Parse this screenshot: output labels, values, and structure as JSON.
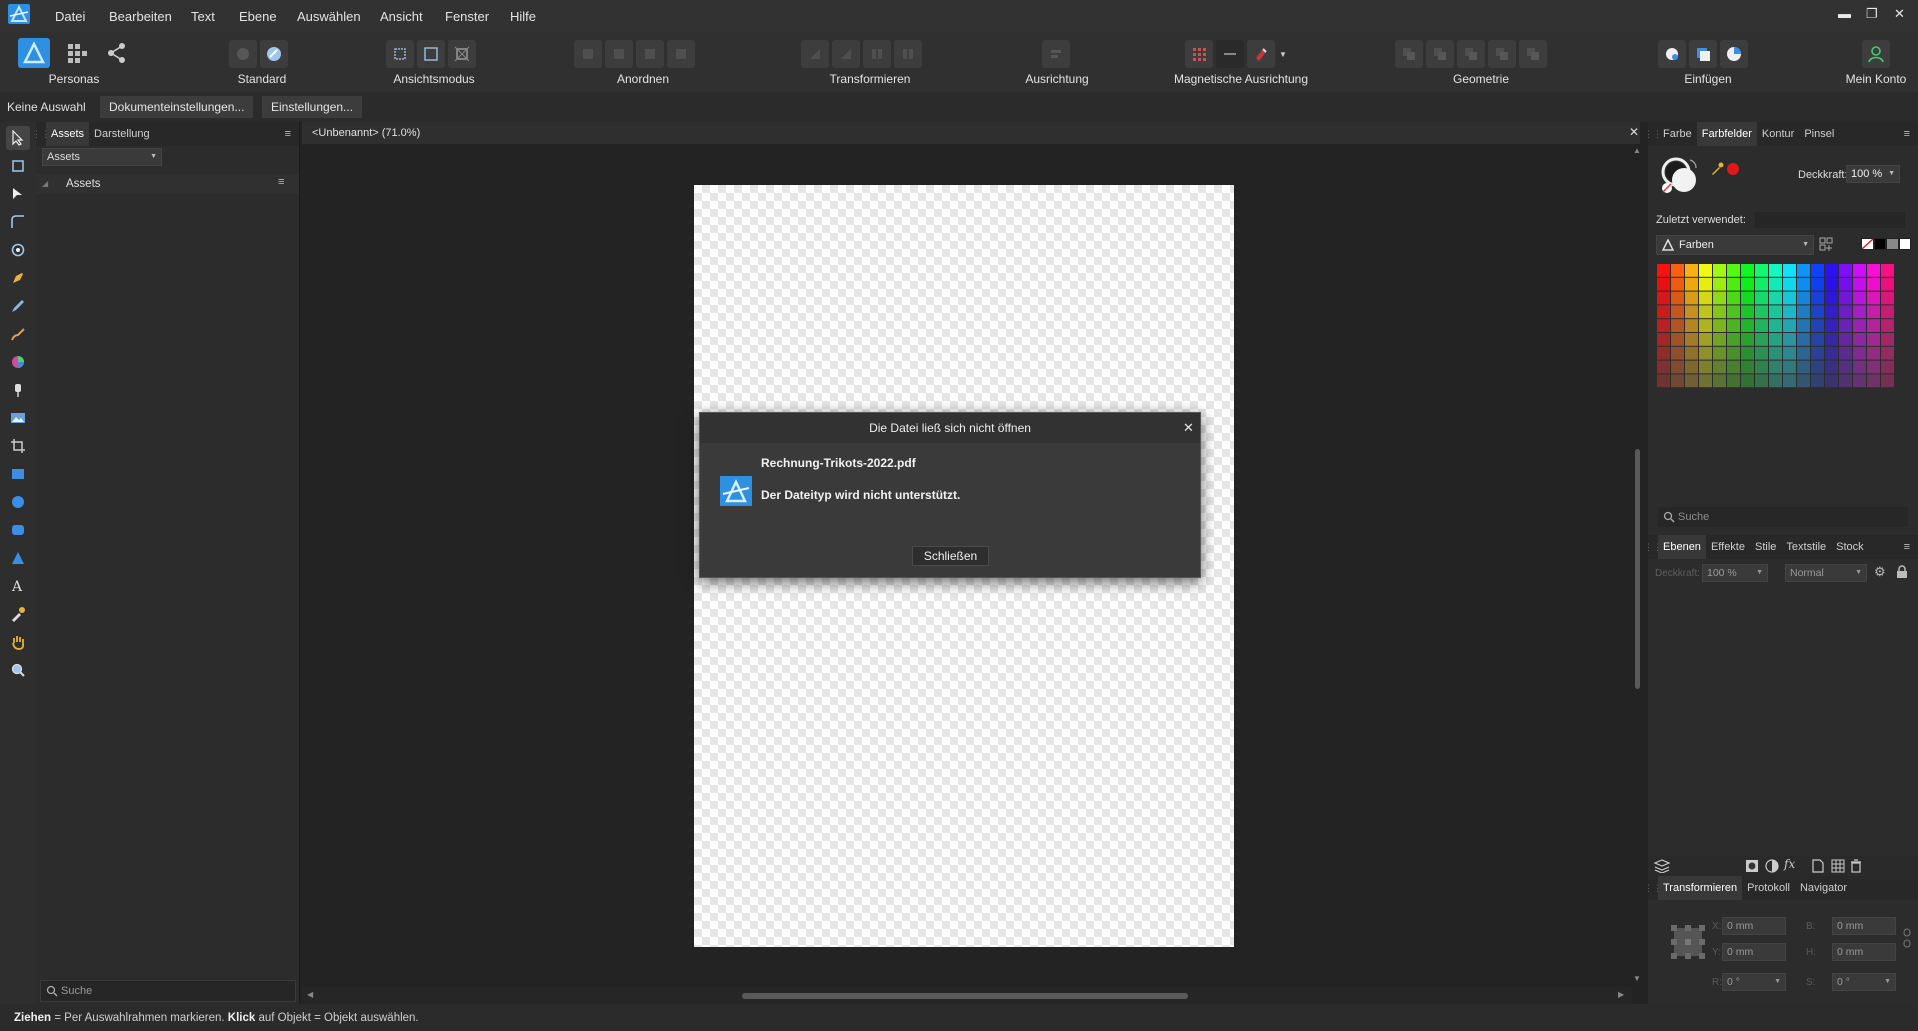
{
  "menubar": {
    "items": [
      "Datei",
      "Bearbeiten",
      "Text",
      "Ebene",
      "Auswählen",
      "Ansicht",
      "Fenster",
      "Hilfe"
    ],
    "window_controls": [
      "▬",
      "❐",
      "✕"
    ]
  },
  "toolbar": {
    "personas_label": "Personas",
    "groups": [
      "Standard",
      "Ansichtsmodus",
      "Anordnen",
      "Transformieren",
      "Ausrichtung",
      "Magnetische Ausrichtung",
      "Geometrie",
      "Einfügen",
      "Mein Konto"
    ]
  },
  "context_bar": {
    "selection": "Keine Auswahl",
    "doc_settings": "Dokumenteinstellungen...",
    "settings": "Einstellungen..."
  },
  "assets_panel": {
    "tabs": [
      "Assets",
      "Darstellung"
    ],
    "dropdown": "Assets",
    "section": "Assets",
    "search_placeholder": "Suche"
  },
  "document": {
    "tab_title": "<Unbenannt> (71.0%)"
  },
  "dialog": {
    "title": "Die Datei ließ sich nicht öffnen",
    "filename": "Rechnung-Trikots-2022.pdf",
    "message": "Der Dateityp wird nicht unterstützt.",
    "close_button": "Schließen"
  },
  "color_panel": {
    "tabs": [
      "Farbe",
      "Farbfelder",
      "Kontur",
      "Pinsel"
    ],
    "opacity_label": "Deckkraft:",
    "opacity_value": "100 %",
    "recent_label": "Zuletzt verwendet:",
    "palette_name": "Farben",
    "search_placeholder": "Suche"
  },
  "layers_panel": {
    "tabs": [
      "Ebenen",
      "Effekte",
      "Stile",
      "Textstile",
      "Stock"
    ],
    "opacity_label": "Deckkraft:",
    "opacity_value": "100 %",
    "blend_mode": "Normal"
  },
  "transform_panel": {
    "tabs": [
      "Transformieren",
      "Protokoll",
      "Navigator"
    ],
    "fields": [
      {
        "label": "X:",
        "value": "0 mm"
      },
      {
        "label": "B:",
        "value": "0 mm"
      },
      {
        "label": "Y:",
        "value": "0 mm"
      },
      {
        "label": "H:",
        "value": "0 mm"
      },
      {
        "label": "R:",
        "value": "0 °"
      },
      {
        "label": "S:",
        "value": "0 °"
      }
    ]
  },
  "status": {
    "bold1": "Ziehen",
    "text1": " = Per Auswahlrahmen markieren. ",
    "bold2": "Klick",
    "text2": " auf Objekt = Objekt auswählen."
  }
}
